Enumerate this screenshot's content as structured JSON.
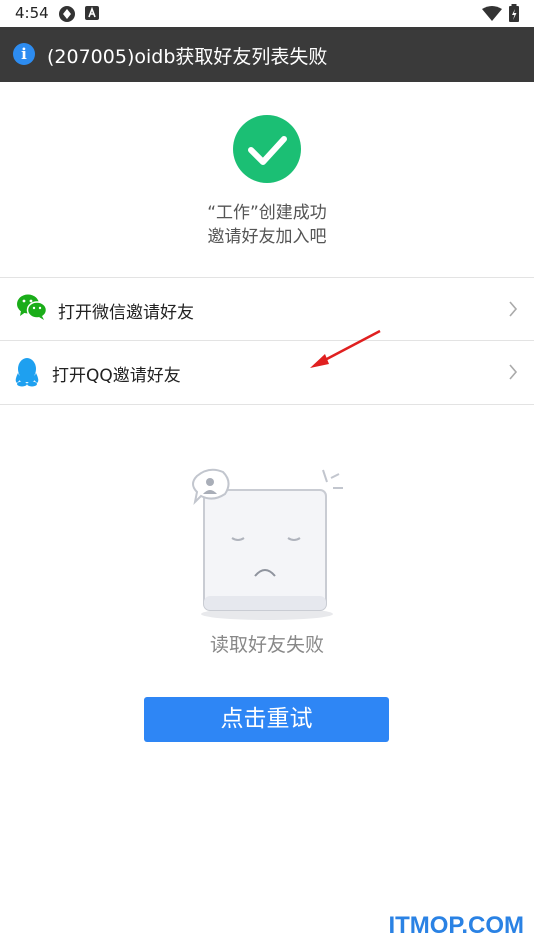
{
  "status_bar": {
    "time": "4:54"
  },
  "toast": {
    "message": "(207005)oidb获取好友列表失败"
  },
  "success": {
    "line1": "“工作”创建成功",
    "line2": "邀请好友加入吧"
  },
  "invite_rows": [
    {
      "label": "打开微信邀请好友",
      "icon": "wechat-icon"
    },
    {
      "label": "打开QQ邀请好友",
      "icon": "qq-icon"
    }
  ],
  "empty_state": {
    "message": "读取好友失败"
  },
  "retry_button": {
    "label": "点击重试"
  },
  "watermark": {
    "text": "ITMOP.COM"
  },
  "colors": {
    "success_green": "#1bbf74",
    "button_blue": "#2e86f5",
    "toast_bg": "#3a3a3a",
    "arrow_red": "#e02020",
    "watermark_blue": "#2a82e4"
  }
}
